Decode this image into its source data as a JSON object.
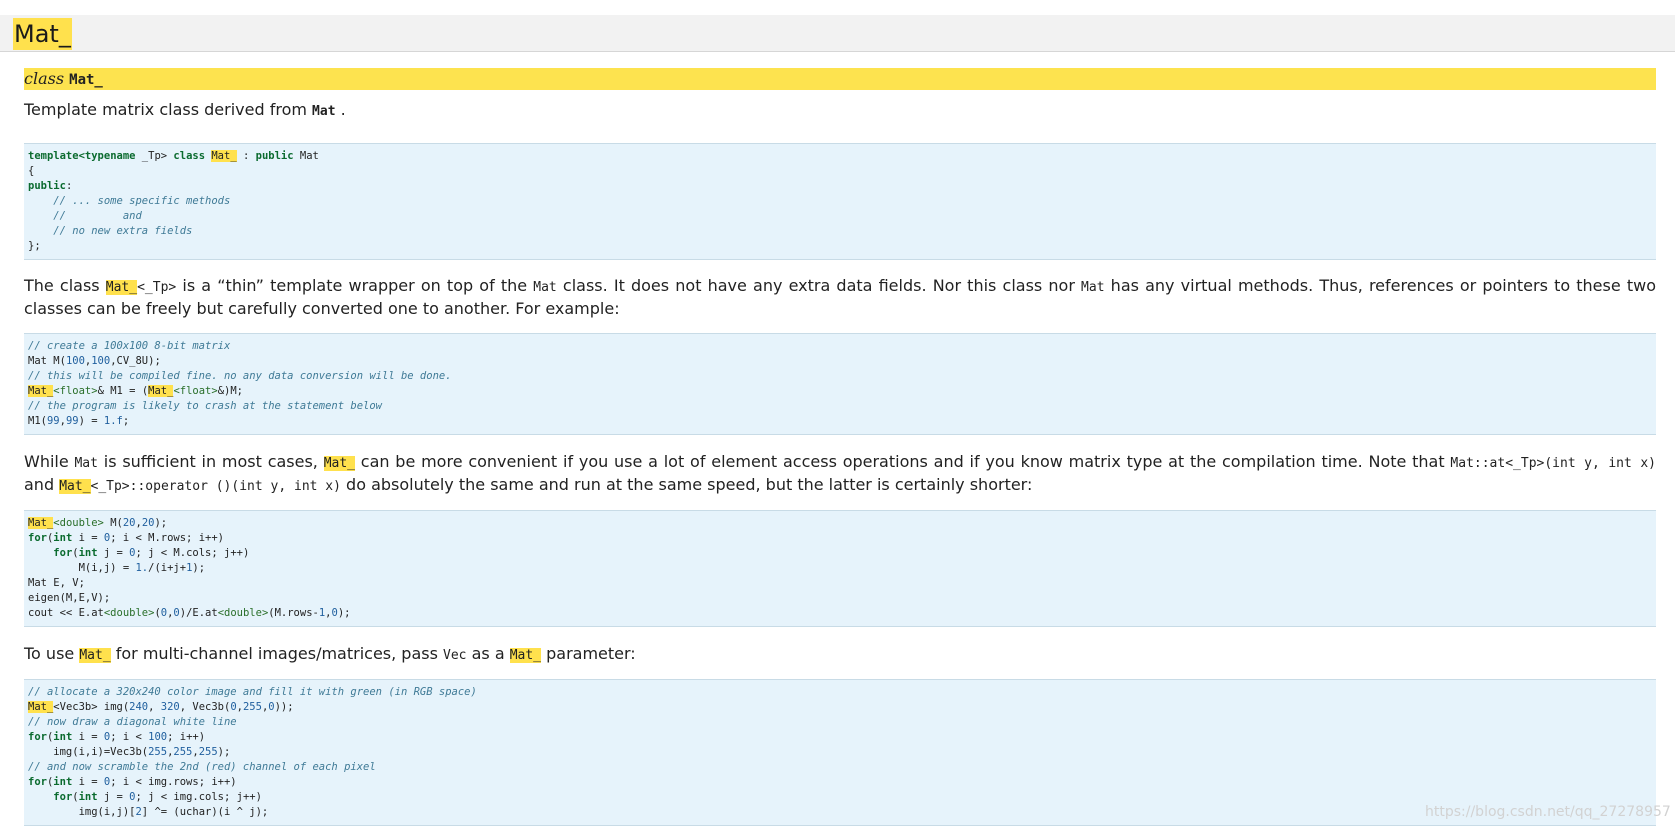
{
  "page_title": "Mat_",
  "class_line": {
    "keyword": "class",
    "name": "Mat_"
  },
  "intro": {
    "text_before": "Template matrix class derived from ",
    "code": "Mat",
    "text_after": " ."
  },
  "code_block_1": [
    [
      [
        "template<",
        "k"
      ],
      [
        "typename",
        "k"
      ],
      [
        " _Tp> ",
        ""
      ],
      [
        "class",
        "k"
      ],
      [
        " ",
        ""
      ],
      [
        "Mat_",
        "hl"
      ],
      [
        " : ",
        ""
      ],
      [
        "public",
        "k"
      ],
      [
        " Mat",
        ""
      ]
    ],
    [
      [
        "{",
        ""
      ]
    ],
    [
      [
        "public",
        "k"
      ],
      [
        ":",
        ""
      ]
    ],
    [
      [
        "    // ... some specific methods",
        "c"
      ]
    ],
    [
      [
        "    //         and",
        "c"
      ]
    ],
    [
      [
        "    // no new extra fields",
        "c"
      ]
    ],
    [
      [
        "};",
        ""
      ]
    ]
  ],
  "para_2": {
    "t1": "The class ",
    "c1": "Mat_",
    "c1b": "<_Tp>",
    "t2": " is a “thin” template wrapper on top of the ",
    "c2": "Mat",
    "t3": " class. It does not have any extra data fields. Nor this class nor ",
    "c3": "Mat",
    "t4": " has any virtual methods. Thus, references or pointers to these two classes can be freely but carefully converted one to another. For example:"
  },
  "code_block_2": [
    [
      [
        "// create a 100x100 8-bit matrix",
        "c"
      ]
    ],
    [
      [
        "Mat M(",
        ""
      ],
      [
        "100",
        "n"
      ],
      [
        ",",
        ""
      ],
      [
        "100",
        "n"
      ],
      [
        ",CV_8U);",
        ""
      ]
    ],
    [
      [
        "// this will be compiled fine. no any data conversion will be done.",
        "c"
      ]
    ],
    [
      [
        "Mat_",
        "hl"
      ],
      [
        "<float>",
        "t"
      ],
      [
        "& M1 = (",
        ""
      ],
      [
        "Mat_",
        "hl"
      ],
      [
        "<float>",
        "t"
      ],
      [
        "&)M;",
        ""
      ]
    ],
    [
      [
        "// the program is likely to crash at the statement below",
        "c"
      ]
    ],
    [
      [
        "M1(",
        ""
      ],
      [
        "99",
        "n"
      ],
      [
        ",",
        ""
      ],
      [
        "99",
        "n"
      ],
      [
        ") = ",
        ""
      ],
      [
        "1.f",
        "n"
      ],
      [
        ";",
        ""
      ]
    ]
  ],
  "para_3": {
    "t1": "While ",
    "c1": "Mat",
    "t2": " is sufficient in most cases, ",
    "c2": "Mat_",
    "t3": " can be more convenient if you use a lot of element access operations and if you know matrix type at the compilation time. Note that ",
    "c3": "Mat::at<_Tp>(int y, int x)",
    "t4": " and ",
    "c4": "Mat_",
    "c4b": "<_Tp>::operator ()(int y, int x)",
    "t5": " do absolutely the same and run at the same speed, but the latter is certainly shorter:"
  },
  "code_block_3": [
    [
      [
        "Mat_",
        "hl"
      ],
      [
        "<double>",
        "t"
      ],
      [
        " M(",
        ""
      ],
      [
        "20",
        "n"
      ],
      [
        ",",
        ""
      ],
      [
        "20",
        "n"
      ],
      [
        ");",
        ""
      ]
    ],
    [
      [
        "for",
        "k"
      ],
      [
        "(",
        ""
      ],
      [
        "int",
        "k"
      ],
      [
        " i = ",
        ""
      ],
      [
        "0",
        "n"
      ],
      [
        "; i < M.rows; i++)",
        ""
      ]
    ],
    [
      [
        "    ",
        ""
      ],
      [
        "for",
        "k"
      ],
      [
        "(",
        ""
      ],
      [
        "int",
        "k"
      ],
      [
        " j = ",
        ""
      ],
      [
        "0",
        "n"
      ],
      [
        "; j < M.cols; j++)",
        ""
      ]
    ],
    [
      [
        "        M(i,j) = ",
        ""
      ],
      [
        "1.",
        "n"
      ],
      [
        "/(i+j+",
        ""
      ],
      [
        "1",
        "n"
      ],
      [
        ");",
        ""
      ]
    ],
    [
      [
        "Mat E, V;",
        ""
      ]
    ],
    [
      [
        "eigen(M,E,V);",
        ""
      ]
    ],
    [
      [
        "cout << E.at",
        ""
      ],
      [
        "<double>",
        "t"
      ],
      [
        "(",
        ""
      ],
      [
        "0",
        "n"
      ],
      [
        ",",
        ""
      ],
      [
        "0",
        "n"
      ],
      [
        ")/E.at",
        ""
      ],
      [
        "<double>",
        "t"
      ],
      [
        "(M.rows-",
        ""
      ],
      [
        "1",
        "n"
      ],
      [
        ",",
        ""
      ],
      [
        "0",
        "n"
      ],
      [
        ");",
        ""
      ]
    ]
  ],
  "para_4": {
    "t1": "To use ",
    "c1": "Mat_",
    "t2": " for multi-channel images/matrices, pass ",
    "c2": "Vec",
    "t3": " as a ",
    "c3": "Mat_",
    "t4": " parameter:"
  },
  "code_block_4": [
    [
      [
        "// allocate a 320x240 color image and fill it with green (in RGB space)",
        "c"
      ]
    ],
    [
      [
        "Mat_",
        "hl"
      ],
      [
        "<Vec3b> img(",
        ""
      ],
      [
        "240",
        "n"
      ],
      [
        ", ",
        ""
      ],
      [
        "320",
        "n"
      ],
      [
        ", Vec3b(",
        ""
      ],
      [
        "0",
        "n"
      ],
      [
        ",",
        ""
      ],
      [
        "255",
        "n"
      ],
      [
        ",",
        ""
      ],
      [
        "0",
        "n"
      ],
      [
        "));",
        ""
      ]
    ],
    [
      [
        "// now draw a diagonal white line",
        "c"
      ]
    ],
    [
      [
        "for",
        "k"
      ],
      [
        "(",
        ""
      ],
      [
        "int",
        "k"
      ],
      [
        " i = ",
        ""
      ],
      [
        "0",
        "n"
      ],
      [
        "; i < ",
        ""
      ],
      [
        "100",
        "n"
      ],
      [
        "; i++)",
        ""
      ]
    ],
    [
      [
        "    img(i,i)=Vec3b(",
        ""
      ],
      [
        "255",
        "n"
      ],
      [
        ",",
        ""
      ],
      [
        "255",
        "n"
      ],
      [
        ",",
        ""
      ],
      [
        "255",
        "n"
      ],
      [
        ");",
        ""
      ]
    ],
    [
      [
        "// and now scramble the 2nd (red) channel of each pixel",
        "c"
      ]
    ],
    [
      [
        "for",
        "k"
      ],
      [
        "(",
        ""
      ],
      [
        "int",
        "k"
      ],
      [
        " i = ",
        ""
      ],
      [
        "0",
        "n"
      ],
      [
        "; i < img.rows; i++)",
        ""
      ]
    ],
    [
      [
        "    ",
        ""
      ],
      [
        "for",
        "k"
      ],
      [
        "(",
        ""
      ],
      [
        "int",
        "k"
      ],
      [
        " j = ",
        ""
      ],
      [
        "0",
        "n"
      ],
      [
        "; j < img.cols; j++)",
        ""
      ]
    ],
    [
      [
        "        img(i,j)[",
        ""
      ],
      [
        "2",
        "n"
      ],
      [
        "] ^= (uchar)(i ^ j);",
        ""
      ]
    ]
  ],
  "watermark": "https://blog.csdn.net/qq_27278957"
}
